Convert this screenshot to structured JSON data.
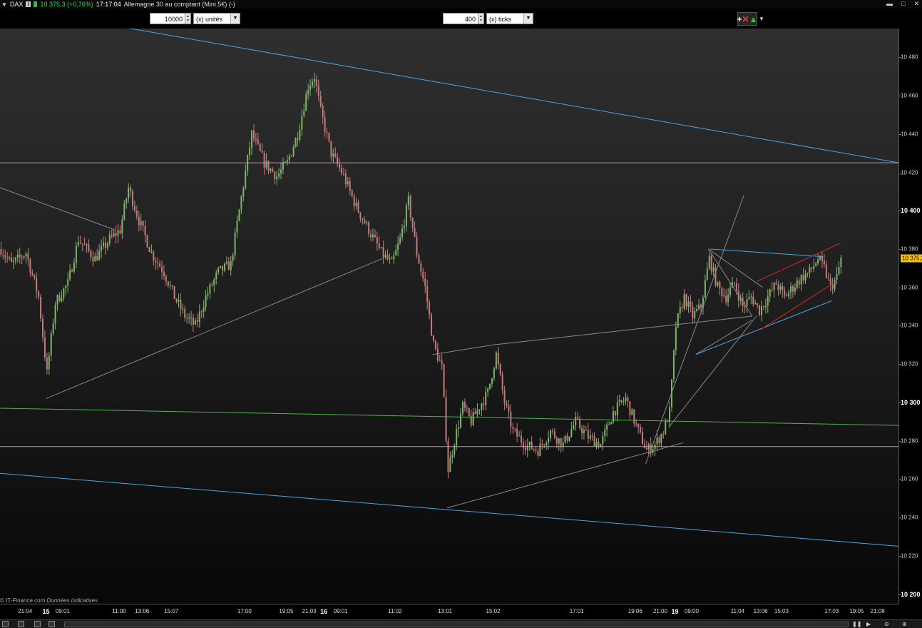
{
  "header": {
    "symbol": "DAX",
    "price_change": "10 375,3 (+0,76%)",
    "time": "17:17:04",
    "instrument": "Allemagne 30 au comptant (Mini 5€) (-)"
  },
  "toolbar": {
    "units_value": "10000",
    "units_label": "(x) unités",
    "ticks_value": "400",
    "ticks_label": "(x) ticks"
  },
  "credit": {
    "source": "© IT-Finance.com",
    "note": "Données indicatives"
  },
  "chart_data": {
    "type": "candlestick",
    "y_axis": {
      "range": [
        10195,
        10495
      ],
      "ticks": [
        {
          "value": 10480,
          "label": "10 480",
          "bold": false
        },
        {
          "value": 10460,
          "label": "10 460",
          "bold": false
        },
        {
          "value": 10440,
          "label": "10 440",
          "bold": false
        },
        {
          "value": 10420,
          "label": "10 420",
          "bold": false
        },
        {
          "value": 10400,
          "label": "10 400",
          "bold": true
        },
        {
          "value": 10380,
          "label": "10 380",
          "bold": false
        },
        {
          "value": 10360,
          "label": "10 360",
          "bold": false
        },
        {
          "value": 10340,
          "label": "10 340",
          "bold": false
        },
        {
          "value": 10320,
          "label": "10 320",
          "bold": false
        },
        {
          "value": 10300,
          "label": "10 300",
          "bold": true
        },
        {
          "value": 10280,
          "label": "10 280",
          "bold": false
        },
        {
          "value": 10260,
          "label": "10 260",
          "bold": false
        },
        {
          "value": 10240,
          "label": "10 240",
          "bold": false
        },
        {
          "value": 10220,
          "label": "10 220",
          "bold": false
        },
        {
          "value": 10200,
          "label": "10 200",
          "bold": true
        }
      ],
      "current_price": 10375.3,
      "current_label": "10 375,3"
    },
    "x_axis": {
      "bars_visible": 430,
      "ticks": [
        {
          "bar": 12,
          "label": "21:04",
          "bold": false
        },
        {
          "bar": 22,
          "label": "15",
          "bold": true
        },
        {
          "bar": 30,
          "label": "09:01",
          "bold": false
        },
        {
          "bar": 57,
          "label": "11:00",
          "bold": false
        },
        {
          "bar": 68,
          "label": "13:06",
          "bold": false
        },
        {
          "bar": 82,
          "label": "15:07",
          "bold": false
        },
        {
          "bar": 117,
          "label": "17:00",
          "bold": false
        },
        {
          "bar": 137,
          "label": "19:05",
          "bold": false
        },
        {
          "bar": 148,
          "label": "21:03",
          "bold": false
        },
        {
          "bar": 155,
          "label": "16",
          "bold": true
        },
        {
          "bar": 163,
          "label": "09:01",
          "bold": false
        },
        {
          "bar": 189,
          "label": "11:02",
          "bold": false
        },
        {
          "bar": 213,
          "label": "13:01",
          "bold": false
        },
        {
          "bar": 236,
          "label": "15:02",
          "bold": false
        },
        {
          "bar": 276,
          "label": "17:01",
          "bold": false
        },
        {
          "bar": 304,
          "label": "19:06",
          "bold": false
        },
        {
          "bar": 316,
          "label": "21:00",
          "bold": false
        },
        {
          "bar": 323,
          "label": "19",
          "bold": true
        },
        {
          "bar": 331,
          "label": "09:00",
          "bold": false
        },
        {
          "bar": 353,
          "label": "11:04",
          "bold": false
        },
        {
          "bar": 364,
          "label": "13:06",
          "bold": false
        },
        {
          "bar": 374,
          "label": "15:03",
          "bold": false
        },
        {
          "bar": 398,
          "label": "17:03",
          "bold": false
        },
        {
          "bar": 410,
          "label": "19:05",
          "bold": false
        },
        {
          "bar": 420,
          "label": "21:08",
          "bold": false
        }
      ]
    },
    "price_path": [
      [
        0,
        10380
      ],
      [
        5,
        10372
      ],
      [
        12,
        10378
      ],
      [
        18,
        10355
      ],
      [
        22,
        10315
      ],
      [
        26,
        10352
      ],
      [
        32,
        10362
      ],
      [
        37,
        10385
      ],
      [
        45,
        10375
      ],
      [
        52,
        10385
      ],
      [
        57,
        10390
      ],
      [
        61,
        10412
      ],
      [
        66,
        10395
      ],
      [
        72,
        10378
      ],
      [
        78,
        10368
      ],
      [
        83,
        10355
      ],
      [
        88,
        10345
      ],
      [
        93,
        10340
      ],
      [
        98,
        10355
      ],
      [
        104,
        10368
      ],
      [
        110,
        10372
      ],
      [
        114,
        10400
      ],
      [
        120,
        10440
      ],
      [
        126,
        10425
      ],
      [
        132,
        10418
      ],
      [
        137,
        10425
      ],
      [
        142,
        10440
      ],
      [
        147,
        10465
      ],
      [
        150,
        10470
      ],
      [
        153,
        10452
      ],
      [
        158,
        10430
      ],
      [
        164,
        10418
      ],
      [
        170,
        10402
      ],
      [
        176,
        10390
      ],
      [
        182,
        10378
      ],
      [
        187,
        10372
      ],
      [
        191,
        10385
      ],
      [
        195,
        10405
      ],
      [
        199,
        10378
      ],
      [
        203,
        10360
      ],
      [
        207,
        10330
      ],
      [
        211,
        10318
      ],
      [
        214,
        10265
      ],
      [
        217,
        10280
      ],
      [
        221,
        10298
      ],
      [
        225,
        10290
      ],
      [
        229,
        10298
      ],
      [
        233,
        10305
      ],
      [
        237,
        10325
      ],
      [
        241,
        10300
      ],
      [
        245,
        10285
      ],
      [
        251,
        10278
      ],
      [
        257,
        10275
      ],
      [
        263,
        10285
      ],
      [
        269,
        10278
      ],
      [
        275,
        10290
      ],
      [
        281,
        10282
      ],
      [
        287,
        10278
      ],
      [
        293,
        10295
      ],
      [
        299,
        10302
      ],
      [
        305,
        10285
      ],
      [
        309,
        10275
      ],
      [
        313,
        10278
      ],
      [
        317,
        10285
      ],
      [
        320,
        10295
      ],
      [
        323,
        10340
      ],
      [
        327,
        10355
      ],
      [
        331,
        10345
      ],
      [
        335,
        10350
      ],
      [
        339,
        10375
      ],
      [
        343,
        10360
      ],
      [
        347,
        10355
      ],
      [
        351,
        10362
      ],
      [
        355,
        10350
      ],
      [
        359,
        10355
      ],
      [
        363,
        10348
      ],
      [
        367,
        10355
      ],
      [
        371,
        10362
      ],
      [
        375,
        10355
      ],
      [
        379,
        10360
      ],
      [
        383,
        10365
      ],
      [
        387,
        10368
      ],
      [
        391,
        10375
      ],
      [
        394,
        10370
      ],
      [
        397,
        10360
      ],
      [
        400,
        10365
      ],
      [
        402,
        10375
      ]
    ],
    "trend_lines": [
      {
        "color": "#4aa3e0",
        "points": [
          [
            52,
            10497
          ],
          [
            430,
            10425
          ]
        ]
      },
      {
        "color": "#4aa3e0",
        "points": [
          [
            0,
            10263
          ],
          [
            430,
            10225
          ]
        ]
      },
      {
        "color": "#c98fb4",
        "points": [
          [
            0,
            10425
          ],
          [
            430,
            10425
          ]
        ]
      },
      {
        "color": "#c98fb4",
        "points": [
          [
            0,
            10277
          ],
          [
            430,
            10277
          ]
        ]
      },
      {
        "color": "#4fb34a",
        "points": [
          [
            0,
            10297
          ],
          [
            430,
            10288
          ]
        ]
      },
      {
        "color": "#888888",
        "points": [
          [
            0,
            10412
          ],
          [
            55,
            10390
          ]
        ]
      },
      {
        "color": "#888888",
        "points": [
          [
            22,
            10302
          ],
          [
            183,
            10375
          ]
        ]
      },
      {
        "color": "#888888",
        "points": [
          [
            207,
            10325
          ],
          [
            236,
            10330
          ]
        ]
      },
      {
        "color": "#888888",
        "points": [
          [
            236,
            10330
          ],
          [
            360,
            10345
          ]
        ]
      },
      {
        "color": "#888888",
        "points": [
          [
            214,
            10245
          ],
          [
            327,
            10279
          ]
        ]
      },
      {
        "color": "#888888",
        "points": [
          [
            309,
            10268
          ],
          [
            356,
            10408
          ]
        ]
      },
      {
        "color": "#888888",
        "points": [
          [
            320,
            10287
          ],
          [
            362,
            10345
          ]
        ]
      },
      {
        "color": "#888888",
        "points": [
          [
            339,
            10380
          ],
          [
            365,
            10360
          ]
        ]
      },
      {
        "color": "#888888",
        "points": [
          [
            339,
            10380
          ],
          [
            360,
            10345
          ]
        ]
      },
      {
        "color": "#888888",
        "points": [
          [
            333,
            10325
          ],
          [
            360,
            10343
          ]
        ]
      },
      {
        "color": "#4aa3e0",
        "points": [
          [
            340,
            10380
          ],
          [
            394,
            10376
          ]
        ]
      },
      {
        "color": "#4aa3e0",
        "points": [
          [
            333,
            10325
          ],
          [
            398,
            10353
          ]
        ]
      },
      {
        "color": "#d12a2a",
        "points": [
          [
            362,
            10363
          ],
          [
            402,
            10383
          ]
        ]
      },
      {
        "color": "#d12a2a",
        "points": [
          [
            364,
            10338
          ],
          [
            400,
            10363
          ]
        ]
      }
    ]
  }
}
